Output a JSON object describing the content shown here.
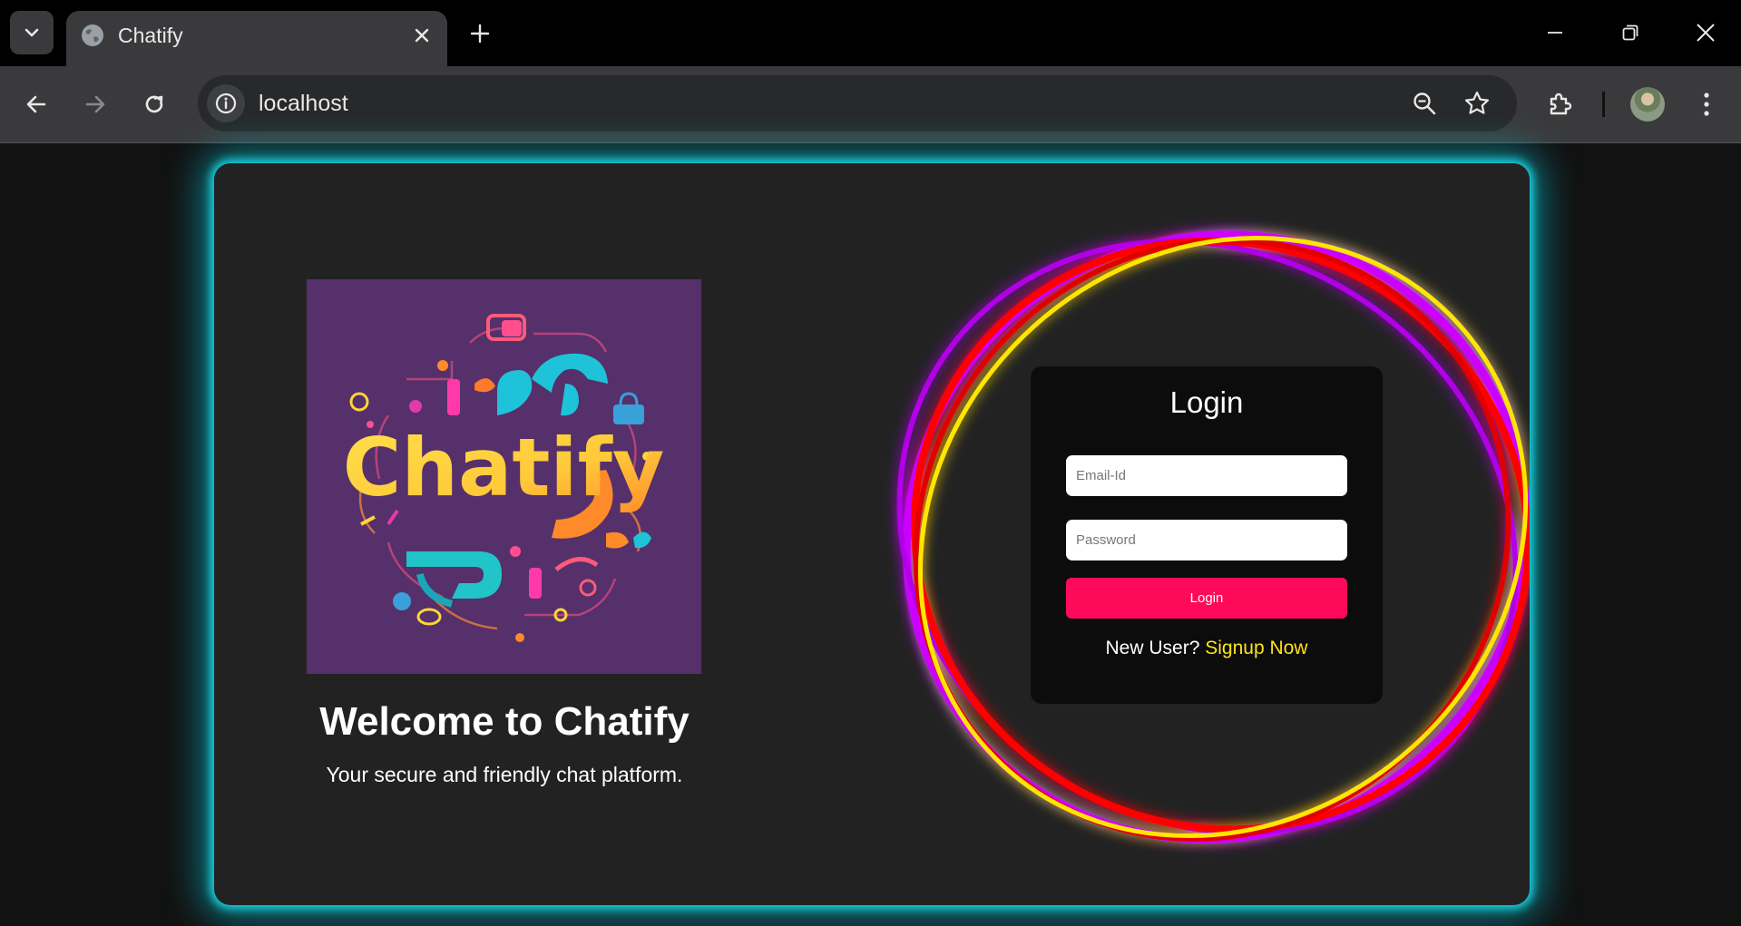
{
  "browser": {
    "tab_title": "Chatify",
    "url": "localhost"
  },
  "page": {
    "logo_text": "Chatify",
    "welcome_title": "Welcome to Chatify",
    "welcome_subtitle": "Your secure and friendly chat platform.",
    "login": {
      "title": "Login",
      "email_placeholder": "Email-Id",
      "password_placeholder": "Password",
      "submit_label": "Login",
      "new_user_text": "New User?",
      "signup_label": "Signup Now"
    }
  },
  "colors": {
    "card_glow": "#19d7e3",
    "login_button": "#ff0a5a",
    "signup_link": "#ffe31a",
    "ring_yellow": "#ffe600",
    "ring_red": "#ff0000",
    "ring_magenta": "#cc00ff",
    "logo_background": "#55306a"
  },
  "icons": [
    "tab-search-icon",
    "globe-icon",
    "close-icon",
    "plus-icon",
    "minimize-icon",
    "restore-icon",
    "back-icon",
    "forward-icon",
    "reload-icon",
    "info-icon",
    "zoom-icon",
    "star-icon",
    "extensions-icon",
    "menu-icon"
  ]
}
